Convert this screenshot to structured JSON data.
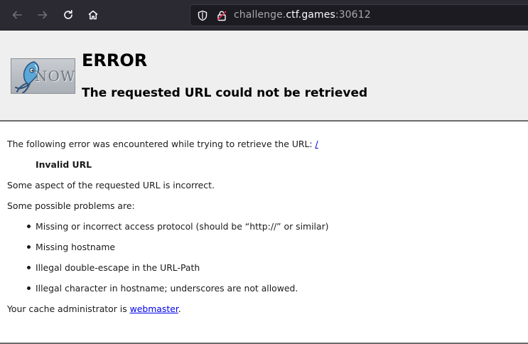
{
  "browser": {
    "url_host": "challenge.",
    "url_domain": "ctf.games",
    "url_port": ":30612",
    "icons": [
      "back-arrow-icon",
      "forward-arrow-icon",
      "reload-icon",
      "home-icon",
      "shield-icon",
      "lock-icon"
    ]
  },
  "header": {
    "logo_text": "NOW",
    "title": "ERROR",
    "subtitle": "The requested URL could not be retrieved"
  },
  "content": {
    "intro_text": "The following error was encountered while trying to retrieve the URL: ",
    "intro_link": "/",
    "error_name": "Invalid URL",
    "aspect_text": "Some aspect of the requested URL is incorrect.",
    "problems_heading": "Some possible problems are:",
    "problems": [
      "Missing or incorrect access protocol (should be “http://” or similar)",
      "Missing hostname",
      "Illegal double-escape in the URL-Path",
      "Illegal character in hostname; underscores are not allowed."
    ],
    "admin_text": "Your cache administrator is ",
    "admin_link": "webmaster",
    "admin_suffix": "."
  }
}
